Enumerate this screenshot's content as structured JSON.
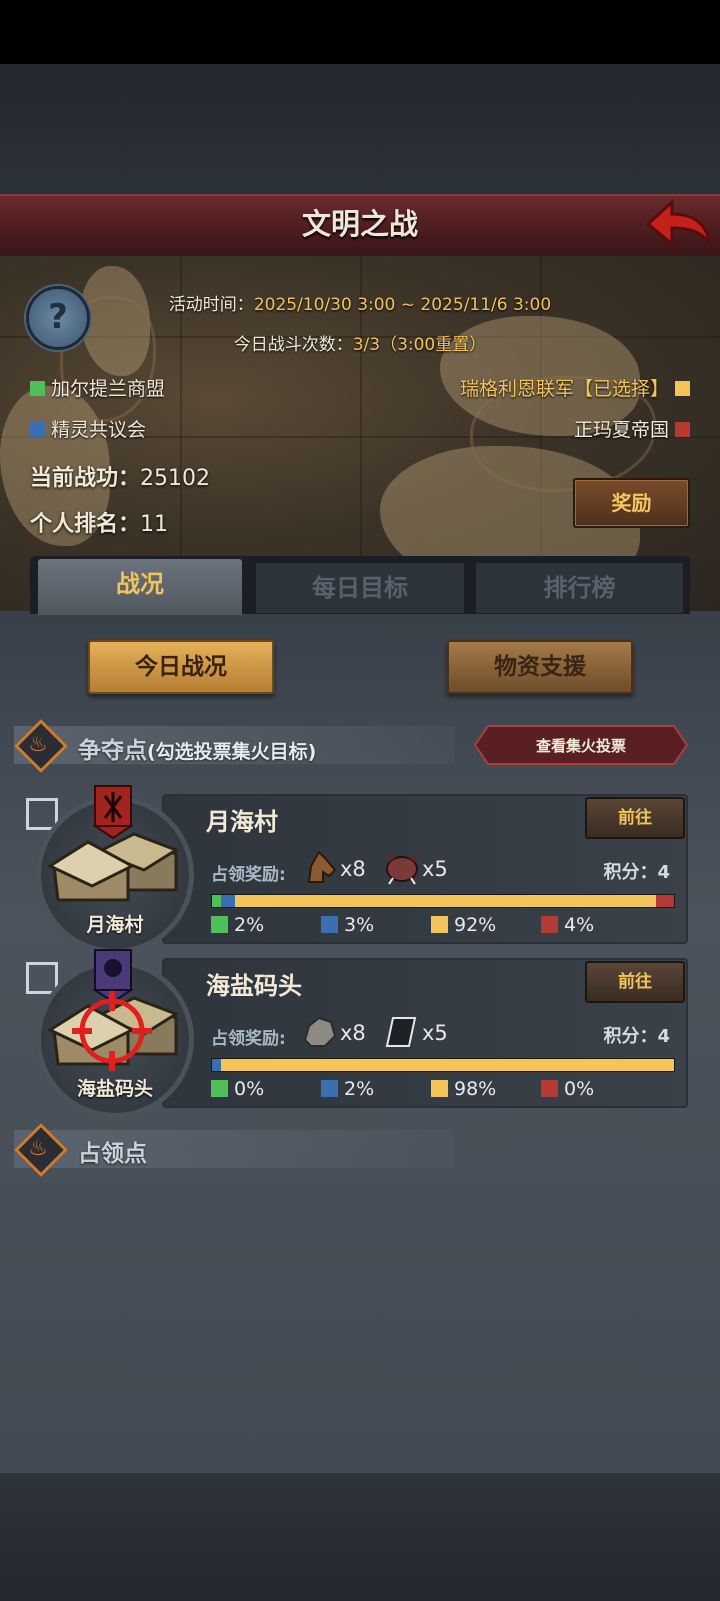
{
  "header": {
    "title": "文明之战"
  },
  "event": {
    "time_label": "活动时间：",
    "time_value": "2025/10/30 3:00 ~ 2025/11/6 3:00",
    "count_label": "今日战斗次数：",
    "count_value": "3/3（3:00重置）"
  },
  "factions": [
    {
      "name": "加尔提兰商盟",
      "color": "#4fbf5a"
    },
    {
      "name": "精灵共议会",
      "color": "#3a6fb0"
    },
    {
      "name": "瑞格利恩联军【已选择】",
      "color": "#f3c45a"
    },
    {
      "name": "正玛夏帝国",
      "color": "#b43a34"
    }
  ],
  "stats": {
    "merit_label": "当前战功：",
    "merit_value": "25102",
    "rank_label": "个人排名：",
    "rank_value": "11"
  },
  "reward_button": "奖励",
  "tabs": [
    {
      "label": "战况",
      "active": true
    },
    {
      "label": "每日目标",
      "active": false
    },
    {
      "label": "排行榜",
      "active": false
    }
  ],
  "buttons": {
    "today": "今日战况",
    "support": "物资支援",
    "vote": "查看集火投票"
  },
  "contest_section": {
    "title": "争夺点",
    "subtitle": "(勾选投票集火目标)"
  },
  "occupy_section": {
    "title": "占领点"
  },
  "points": [
    {
      "name": "月海村",
      "caption": "月海村",
      "go": "前往",
      "reward_label": "占领奖励:",
      "rewards": [
        {
          "icon": "horse-head-icon",
          "qty": "x8"
        },
        {
          "icon": "boar-head-icon",
          "qty": "x5"
        }
      ],
      "score": "积分：4",
      "shares": [
        2,
        3,
        92,
        4
      ],
      "pcts": [
        "2%",
        "3%",
        "92%",
        "4%"
      ],
      "banner_color": "#a3231f",
      "targeted": false
    },
    {
      "name": "海盐码头",
      "caption": "海盐码头",
      "go": "前往",
      "reward_label": "占领奖励:",
      "rewards": [
        {
          "icon": "stone-icon",
          "qty": "x8"
        },
        {
          "icon": "iron-ingot-icon",
          "qty": "x5"
        }
      ],
      "score": "积分：4",
      "shares": [
        0,
        2,
        98,
        0
      ],
      "pcts": [
        "0%",
        "2%",
        "98%",
        "0%"
      ],
      "banner_color": "#4a3a78",
      "targeted": true
    }
  ],
  "share_colors": [
    "#4fbf5a",
    "#3a6fb0",
    "#f3c45a",
    "#b43a34"
  ]
}
